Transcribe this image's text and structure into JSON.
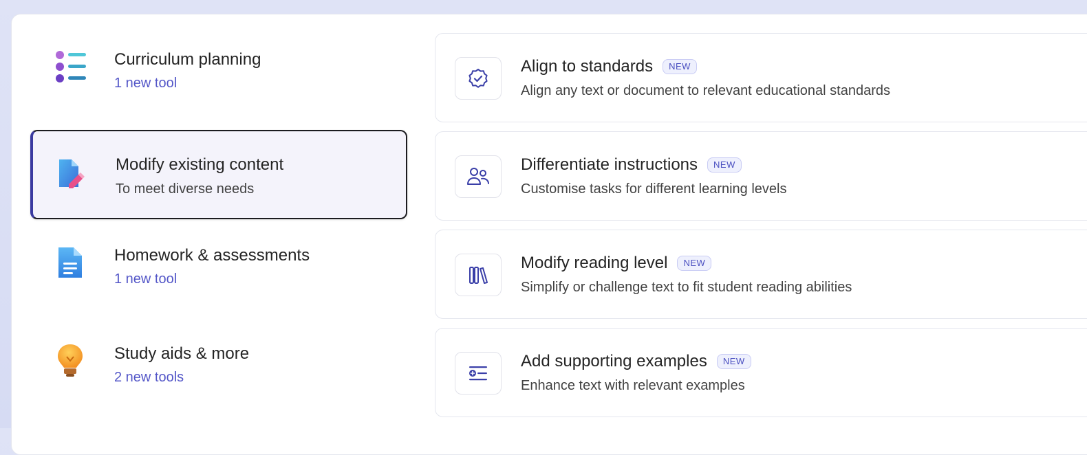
{
  "categories": [
    {
      "title": "Curriculum planning",
      "subtitle": "1 new tool",
      "icon": "list-icon",
      "selected": false
    },
    {
      "title": "Modify existing content",
      "subtitle": "To meet diverse needs",
      "icon": "edit-document-icon",
      "selected": true
    },
    {
      "title": "Homework & assessments",
      "subtitle": "1 new tool",
      "icon": "document-icon",
      "selected": false
    },
    {
      "title": "Study aids & more",
      "subtitle": "2 new tools",
      "icon": "lightbulb-icon",
      "selected": false
    }
  ],
  "tools": [
    {
      "title": "Align to standards",
      "badge": "NEW",
      "description": "Align any text or document to relevant educational standards",
      "icon": "checkmark-badge-icon"
    },
    {
      "title": "Differentiate instructions",
      "badge": "NEW",
      "description": "Customise tasks for different learning levels",
      "icon": "people-icon"
    },
    {
      "title": "Modify reading level",
      "badge": "NEW",
      "description": "Simplify or challenge text to fit student reading abilities",
      "icon": "books-icon"
    },
    {
      "title": "Add supporting examples",
      "badge": "NEW",
      "description": "Enhance text with relevant examples",
      "icon": "add-text-icon"
    }
  ],
  "colors": {
    "accent": "#5457c8",
    "selected_border": "#1b1b1f",
    "badge_bg": "#eef0fd"
  }
}
